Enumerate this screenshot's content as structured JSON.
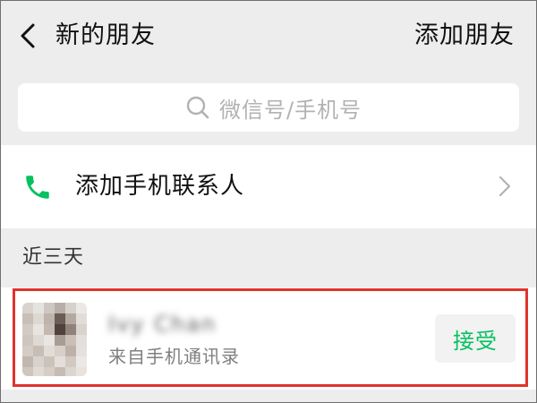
{
  "nav": {
    "title": "新的朋友",
    "action": "添加朋友"
  },
  "search": {
    "placeholder": "微信号/手机号"
  },
  "phone_contacts": {
    "label": "添加手机联系人"
  },
  "section": {
    "label": "近三天"
  },
  "request": {
    "name": "Ivy Chan",
    "source": "来自手机通讯录",
    "accept_label": "接受"
  },
  "colors": {
    "accent_green": "#07c160",
    "highlight_red": "#e0332c",
    "background": "#ededed"
  }
}
